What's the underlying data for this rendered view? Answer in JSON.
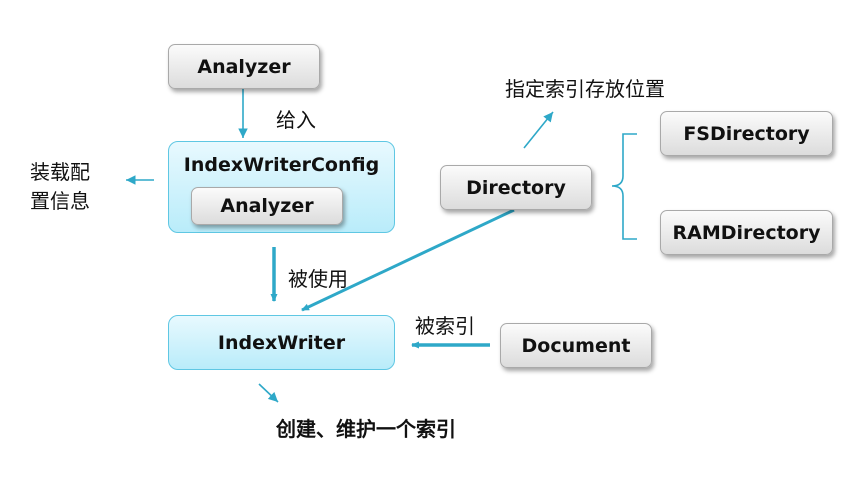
{
  "nodes": {
    "analyzer_top": "Analyzer",
    "index_writer_config": "IndexWriterConfig",
    "analyzer_inner": "Analyzer",
    "directory": "Directory",
    "fs_directory": "FSDirectory",
    "ram_directory": "RAMDirectory",
    "index_writer": "IndexWriter",
    "document": "Document"
  },
  "labels": {
    "give_in": "给入",
    "config_info_line1": "装载配",
    "config_info_line2": "置信息",
    "specify_location": "指定索引存放位置",
    "used_by": "被使用",
    "indexed_by": "被索引",
    "create_maintain": "创建、维护一个索引"
  },
  "colors": {
    "arrow": "#2ea8c8",
    "blue_border": "#5fc7e3",
    "blue_fill": "#c8f0fb",
    "gray_fill": "#e6e6e6"
  }
}
